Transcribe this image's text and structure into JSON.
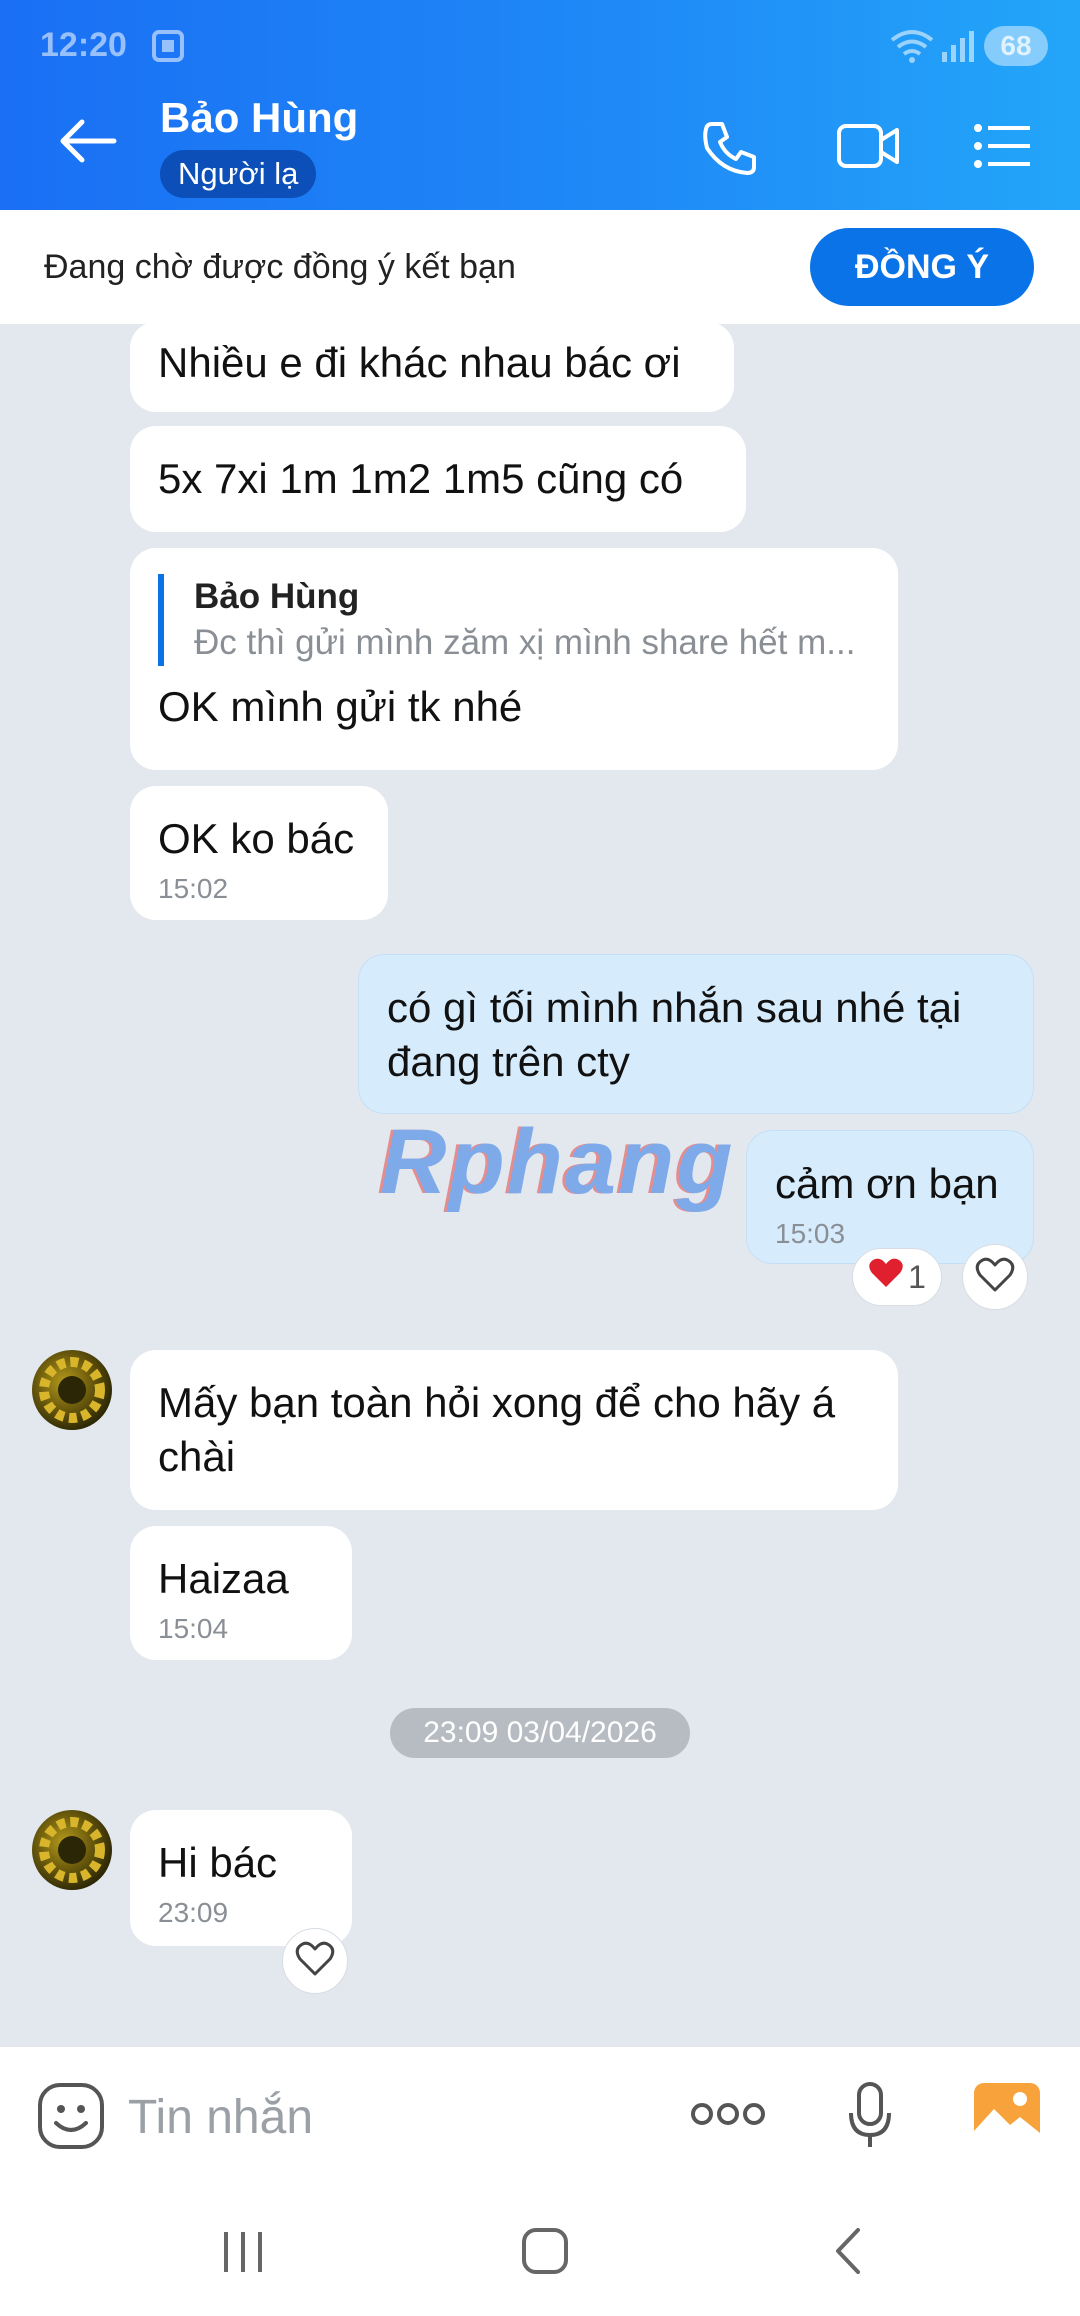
{
  "status": {
    "time": "12:20",
    "battery": "68"
  },
  "header": {
    "name": "Bảo Hùng",
    "badge": "Người lạ"
  },
  "friend_request": {
    "text": "Đang chờ được đồng ý kết bạn",
    "button": "ĐỒNG Ý"
  },
  "messages": [
    {
      "text": "Nhiều e đi khác nhau bác ơi"
    },
    {
      "text": "5x 7xi 1m 1m2 1m5 cũng có"
    },
    {
      "quote_name": "Bảo Hùng",
      "quote_text": "Đc thì gửi mình zăm xị mình share hết m...",
      "text": "OK mình gửi tk nhé"
    },
    {
      "text": "OK ko bác",
      "time": "15:02"
    },
    {
      "text": "có gì tối mình nhắn sau nhé tại đang trên cty"
    },
    {
      "text": "cảm ơn bạn",
      "time": "15:03",
      "reaction_count": "1"
    },
    {
      "text": "Mấy bạn toàn hỏi xong để cho hãy á chài"
    },
    {
      "text": "Haizaa",
      "time": "15:04"
    },
    {
      "text": "Hi bác",
      "time": "23:09"
    }
  ],
  "date_separator": "23:09 03/04/2026",
  "watermark": "Rphang",
  "composer": {
    "placeholder": "Tin nhắn"
  },
  "colors": {
    "header": "#1f8bf7",
    "accent": "#0a73e8",
    "my_bubble": "#d6ecfd",
    "background": "#e3e8ef"
  }
}
